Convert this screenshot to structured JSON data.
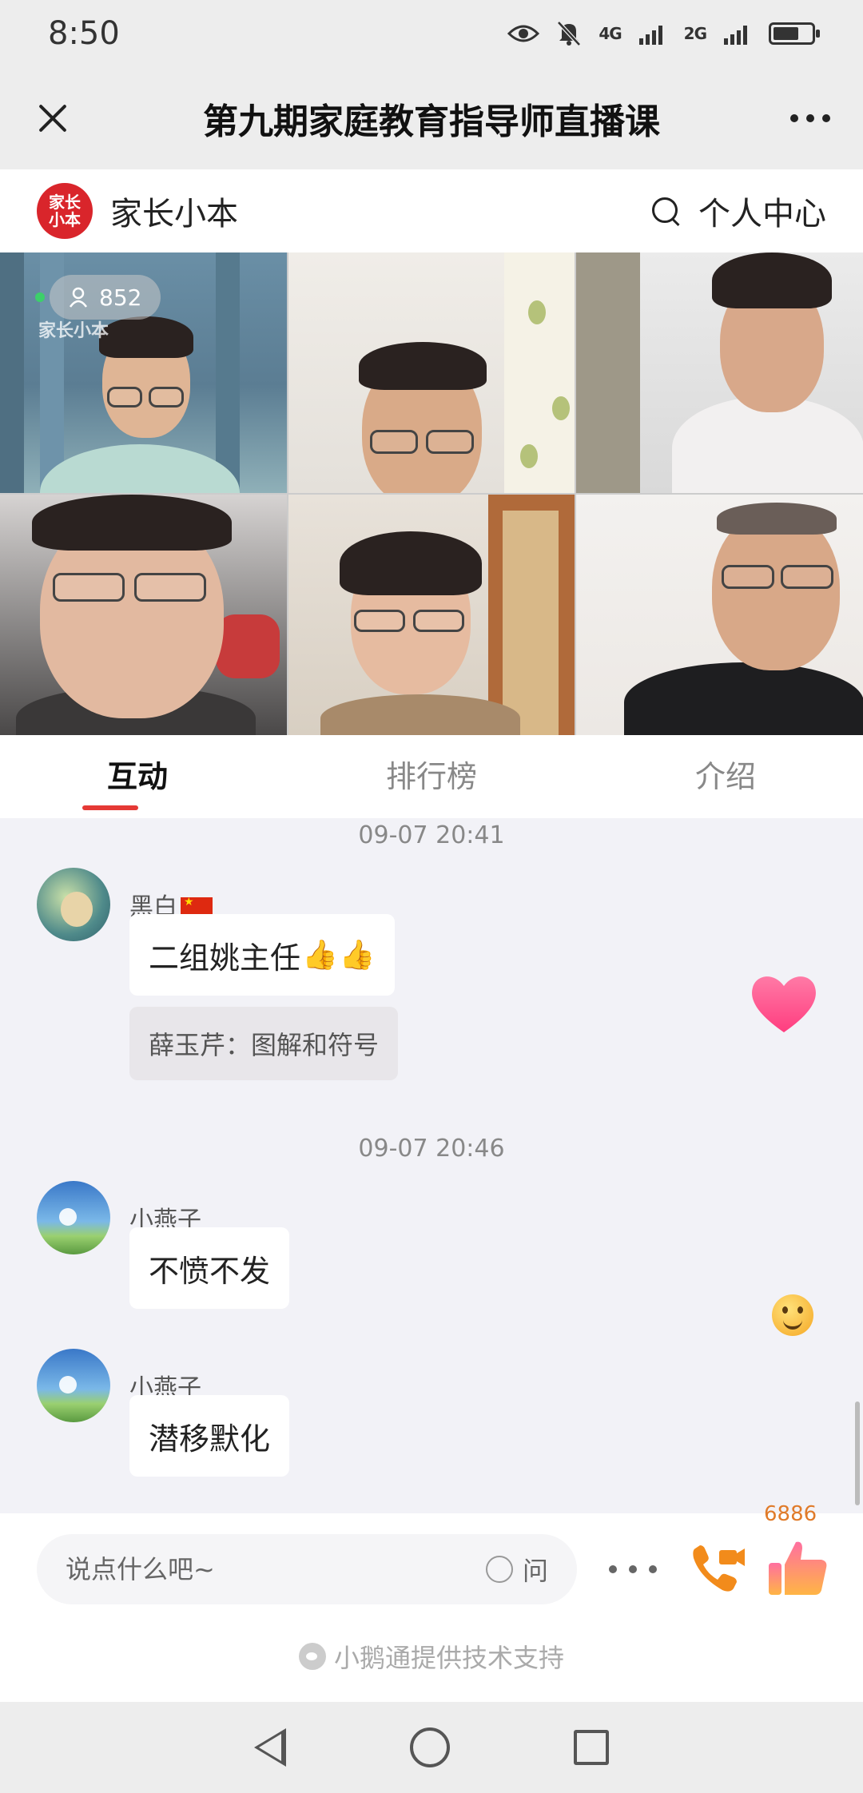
{
  "status_bar": {
    "time": "8:50",
    "network_1": "4G",
    "network_2": "2G"
  },
  "title_bar": {
    "title": "第九期家庭教育指导师直播课"
  },
  "app_header": {
    "logo_text": "家长小本",
    "brand_name": "家长小本",
    "personal_center": "个人中心"
  },
  "video": {
    "viewer_count": "852",
    "watermark": "家长小本"
  },
  "tabs": [
    {
      "label": "互动",
      "active": true
    },
    {
      "label": "排行榜",
      "active": false
    },
    {
      "label": "介绍",
      "active": false
    }
  ],
  "chat": {
    "groups": [
      {
        "timestamp": "09-07 20:41",
        "messages": [
          {
            "username": "黑白",
            "text": "二组姚主任",
            "quote": "薛玉芹：图解和符号"
          }
        ]
      },
      {
        "timestamp": "09-07 20:46",
        "messages": [
          {
            "username": "小燕子",
            "text": "不愤不发"
          },
          {
            "username": "小燕子",
            "text": "潜移默化"
          }
        ]
      }
    ]
  },
  "bottom": {
    "input_placeholder": "说点什么吧~",
    "ask_label": "问",
    "like_count": "6886",
    "powered_by": "小鹅通提供技术支持"
  },
  "colors": {
    "accent": "#e53935",
    "logo": "#d9252b",
    "like_count": "#e07b2a"
  }
}
